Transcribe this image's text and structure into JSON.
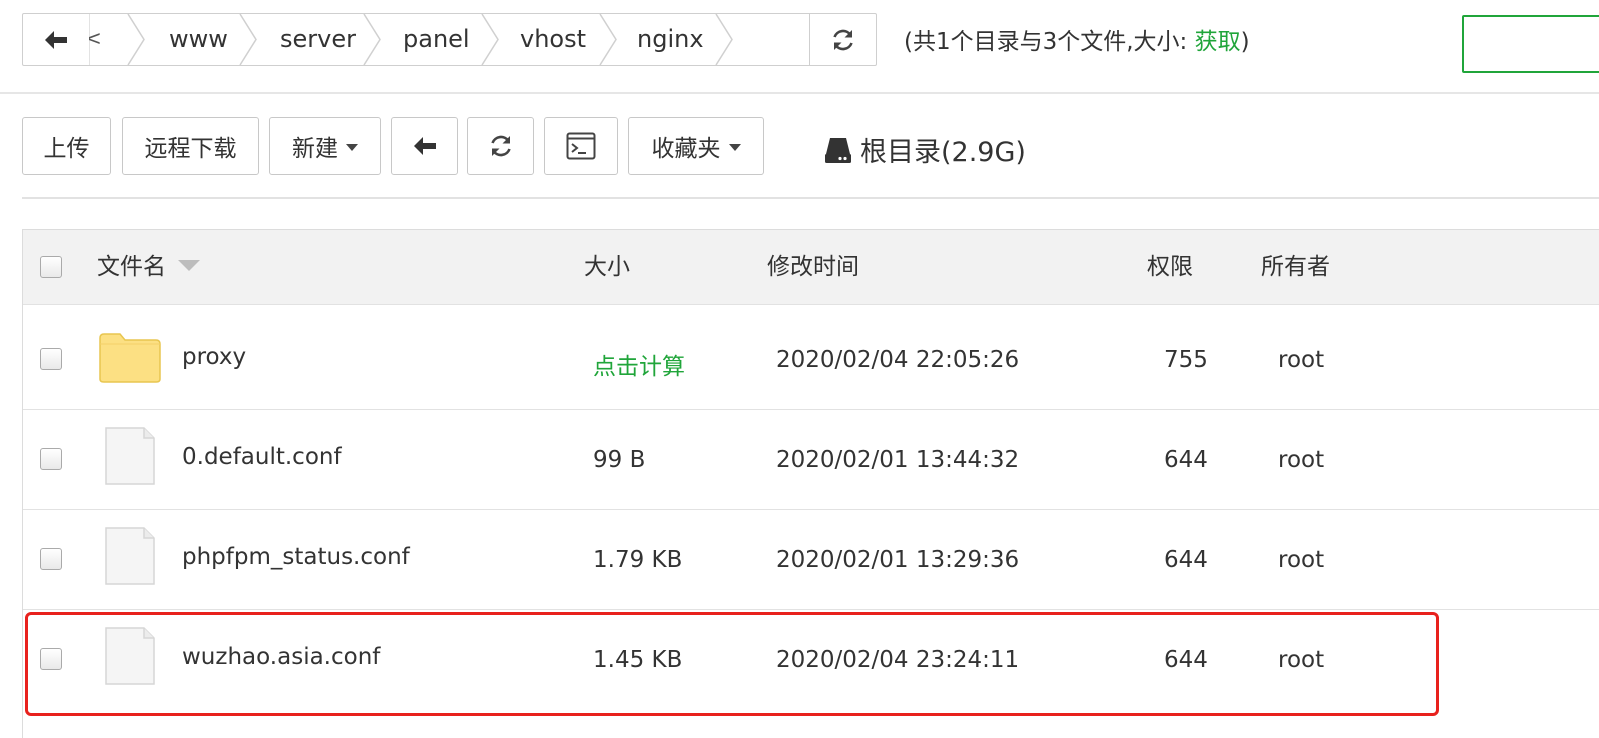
{
  "pathbar": {
    "truncated_glyph": "<",
    "crumbs": [
      "www",
      "server",
      "panel",
      "vhost",
      "nginx"
    ]
  },
  "summary": {
    "prefix": "(共1个目录与3个文件,大小: ",
    "get_link": "获取",
    "suffix": ")"
  },
  "toolbar": {
    "upload": "上传",
    "remote_download": "远程下载",
    "new": "新建",
    "favorites": "收藏夹"
  },
  "disk": {
    "label": "根目录(2.9G)"
  },
  "table": {
    "headers": {
      "name": "文件名",
      "size": "大小",
      "mtime": "修改时间",
      "perm": "权限",
      "owner": "所有者"
    },
    "rows": [
      {
        "type": "folder",
        "name": "proxy",
        "size": "点击计算",
        "mtime": "2020/02/04 22:05:26",
        "perm": "755",
        "owner": "root"
      },
      {
        "type": "file",
        "name": "0.default.conf",
        "size": "99 B",
        "mtime": "2020/02/01 13:44:32",
        "perm": "644",
        "owner": "root"
      },
      {
        "type": "file",
        "name": "phpfpm_status.conf",
        "size": "1.79 KB",
        "mtime": "2020/02/01 13:29:36",
        "perm": "644",
        "owner": "root"
      },
      {
        "type": "file",
        "name": "wuzhao.asia.conf",
        "size": "1.45 KB",
        "mtime": "2020/02/04 23:24:11",
        "perm": "644",
        "owner": "root"
      }
    ]
  },
  "colors": {
    "accent_green": "#20a53a",
    "highlight_red": "#e8211d",
    "folder_yellow": "#fce083"
  }
}
